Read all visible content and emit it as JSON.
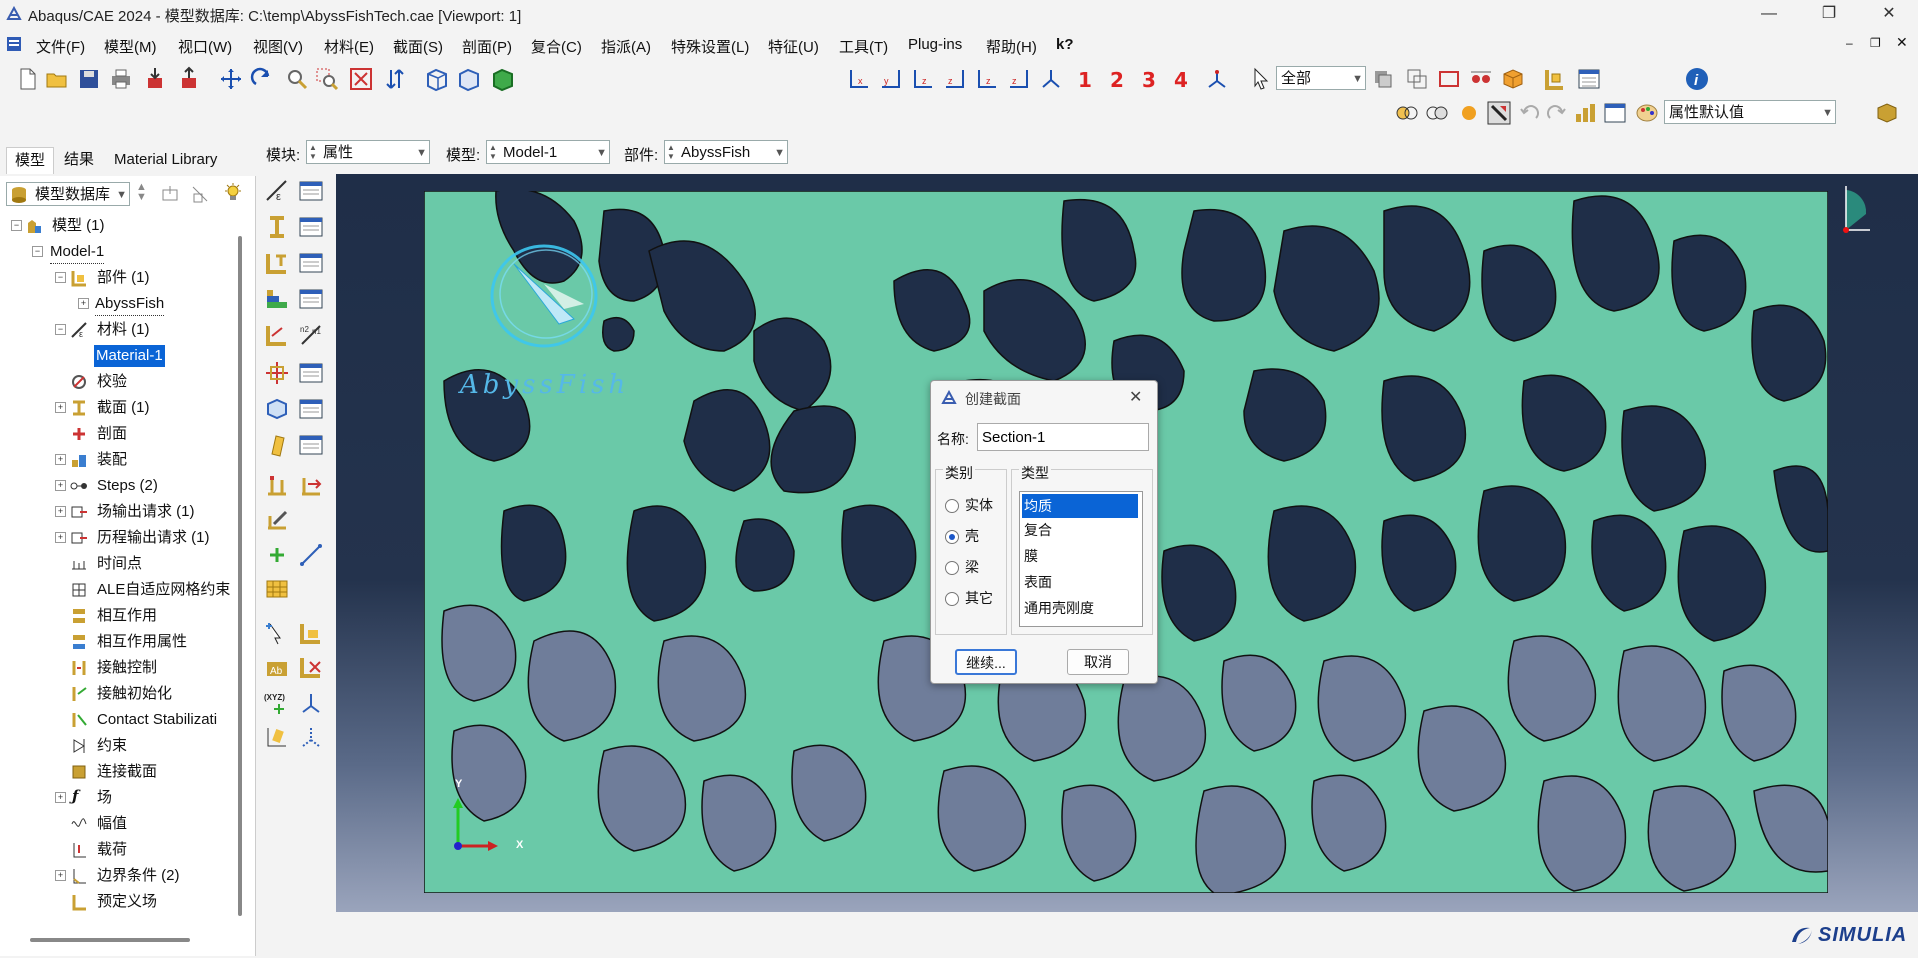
{
  "window": {
    "title": "Abaqus/CAE 2024 - 模型数据库: C:\\temp\\AbyssFishTech.cae [Viewport: 1]",
    "minimize": "—",
    "maximize": "❐",
    "close": "✕"
  },
  "menu": {
    "items": [
      "文件(F)",
      "模型(M)",
      "视口(W)",
      "视图(V)",
      "材料(E)",
      "截面(S)",
      "剖面(P)",
      "复合(C)",
      "指派(A)",
      "特殊设置(L)",
      "特征(U)",
      "工具(T)",
      "Plug-ins",
      "帮助(H)",
      "k?"
    ]
  },
  "toolbar": {
    "numbers": [
      "1",
      "2",
      "3",
      "4"
    ],
    "selection_combo": "全部",
    "attribute_combo": "属性默认值"
  },
  "left_tabs": [
    "模型",
    "结果",
    "Material Library"
  ],
  "tree_combo": "模型数据库",
  "tree": {
    "rows": [
      "模型 (1)",
      "Model-1",
      "部件 (1)",
      "AbyssFish",
      "材料 (1)",
      "Material-1",
      "校验",
      "截面 (1)",
      "剖面",
      "装配",
      "Steps (2)",
      "场输出请求 (1)",
      "历程输出请求 (1)",
      "时间点",
      "ALE自适应网格约束",
      "相互作用",
      "相互作用属性",
      "接触控制",
      "接触初始化",
      "Contact Stabilizati",
      "约束",
      "连接截面",
      "场",
      "幅值",
      "载荷",
      "边界条件 (2)",
      "预定义场"
    ]
  },
  "module_bar": {
    "module_label": "模块:",
    "module_value": "属性",
    "model_label": "模型:",
    "model_value": "Model-1",
    "part_label": "部件:",
    "part_value": "AbyssFish"
  },
  "logo": {
    "text": "AbyssFish"
  },
  "axes": {
    "y": "Y",
    "x": "X"
  },
  "dialog": {
    "title": "创建截面",
    "name_label": "名称:",
    "name_value": "Section-1",
    "category_label": "类别",
    "categories": [
      "实体",
      "壳",
      "梁",
      "其它"
    ],
    "selected_category": "壳",
    "type_label": "类型",
    "types": [
      "均质",
      "复合",
      "膜",
      "表面",
      "通用壳刚度"
    ],
    "selected_type": "均质",
    "continue_button": "继续...",
    "cancel_button": "取消"
  },
  "brand": {
    "name": "SIMULIA"
  },
  "colors": {
    "viewport_top": "#1f2e48",
    "plate": "#6ac9a8",
    "selection": "#0a64d6",
    "red_numbers": "#dd2222"
  }
}
